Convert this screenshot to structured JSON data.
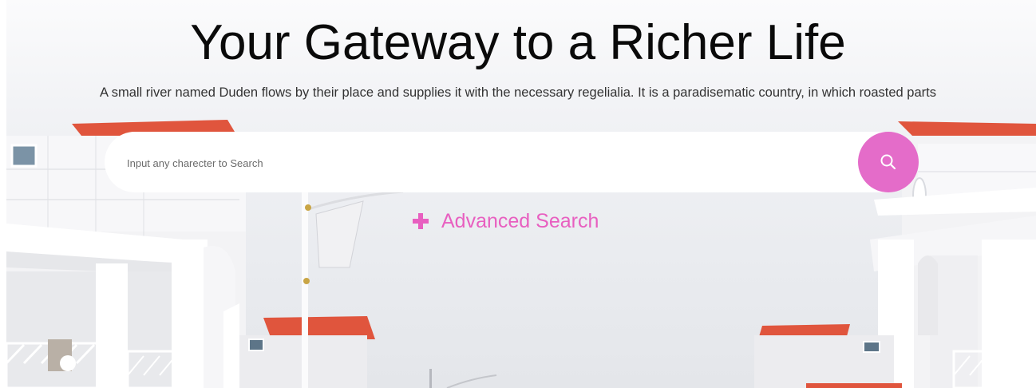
{
  "hero": {
    "title": "Your Gateway to a Richer Life",
    "subtitle": "A small river named Duden flows by their place and supplies it with the necessary regelialia. It is a paradisematic country, in which roasted parts"
  },
  "search": {
    "placeholder": "Input any charecter to Search",
    "button_icon": "search-icon",
    "button_color": "#e46cc9"
  },
  "advanced_search": {
    "icon": "plus-icon",
    "label": "Advanced Search",
    "color": "#e85fc0"
  },
  "colors": {
    "roof": "#e0553d",
    "walls": "#ffffff"
  }
}
